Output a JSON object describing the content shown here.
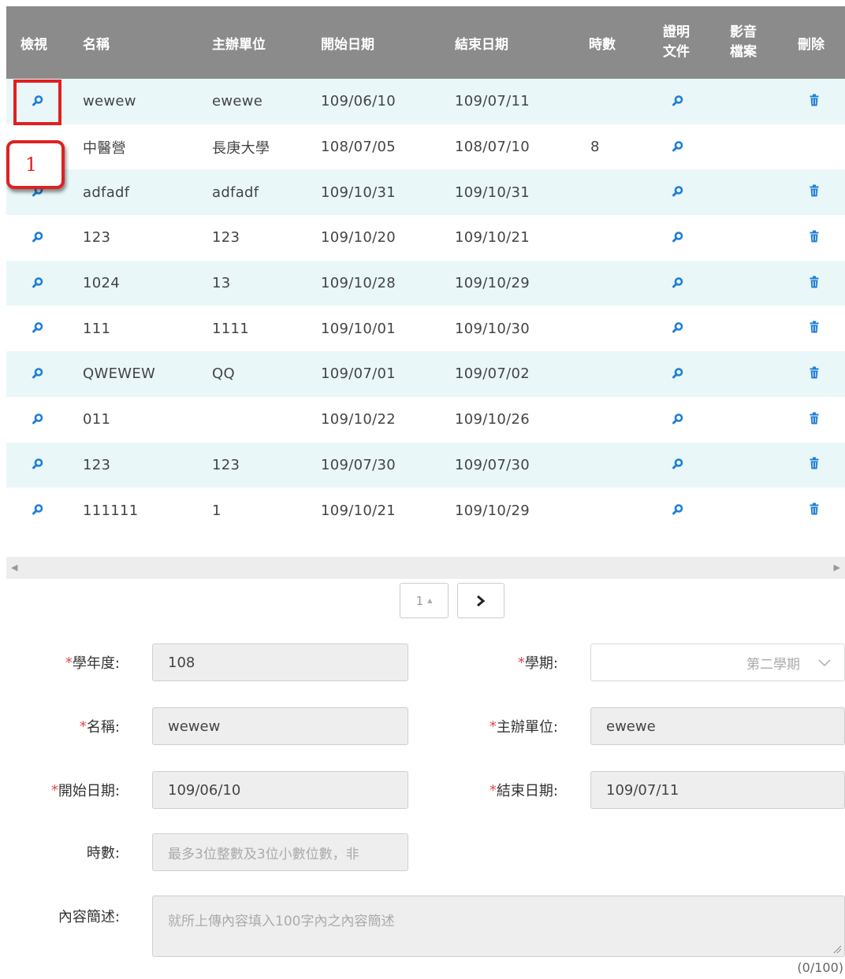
{
  "table": {
    "headers": {
      "view": "檢視",
      "name": "名稱",
      "organizer": "主辦單位",
      "start": "開始日期",
      "end": "結束日期",
      "hours": "時數",
      "proof_1": "證明",
      "proof_2": "文件",
      "media_1": "影音",
      "media_2": "檔案",
      "delete": "刪除"
    },
    "rows": [
      {
        "name": "wewew",
        "organizer": "ewewe",
        "start": "109/06/10",
        "end": "109/07/11",
        "hours": "",
        "deletable": true
      },
      {
        "name": "中醫營",
        "organizer": "長庚大學",
        "start": "108/07/05",
        "end": "108/07/10",
        "hours": "8",
        "deletable": false
      },
      {
        "name": "adfadf",
        "organizer": "adfadf",
        "start": "109/10/31",
        "end": "109/10/31",
        "hours": "",
        "deletable": true
      },
      {
        "name": "123",
        "organizer": "123",
        "start": "109/10/20",
        "end": "109/10/21",
        "hours": "",
        "deletable": true
      },
      {
        "name": "1024",
        "organizer": "13",
        "start": "109/10/28",
        "end": "109/10/29",
        "hours": "",
        "deletable": true
      },
      {
        "name": "111",
        "organizer": "1111",
        "start": "109/10/01",
        "end": "109/10/30",
        "hours": "",
        "deletable": true
      },
      {
        "name": "QWEWEW",
        "organizer": "QQ",
        "start": "109/07/01",
        "end": "109/07/02",
        "hours": "",
        "deletable": true
      },
      {
        "name": "011",
        "organizer": "",
        "start": "109/10/22",
        "end": "109/10/26",
        "hours": "",
        "deletable": true
      },
      {
        "name": "123",
        "organizer": "123",
        "start": "109/07/30",
        "end": "109/07/30",
        "hours": "",
        "deletable": true
      },
      {
        "name": "111111",
        "organizer": "1",
        "start": "109/10/21",
        "end": "109/10/29",
        "hours": "",
        "deletable": true
      }
    ]
  },
  "pager": {
    "page": "1",
    "sort_glyph": "▲"
  },
  "form": {
    "year_label": "學年度:",
    "year_value": "108",
    "semester_label": "學期:",
    "semester_value": "第二學期",
    "name_label": "名稱:",
    "name_value": "wewew",
    "organizer_label": "主辦單位:",
    "organizer_value": "ewewe",
    "start_label": "開始日期:",
    "start_value": "109/06/10",
    "end_label": "結束日期:",
    "end_value": "109/07/11",
    "hours_label": "時數:",
    "hours_placeholder": "最多3位整數及3位小數位數，非",
    "desc_label": "內容簡述:",
    "desc_placeholder": "就所上傳內容填入100字內之內容簡述",
    "counter": "(0/100)",
    "required_mark": "*"
  },
  "annotation": {
    "step": "1"
  },
  "colors": {
    "header_bg": "#8b8b8b",
    "row_alt_bg": "#e9f7f8",
    "icon_blue": "#1f7fd6",
    "required_red": "#e04848",
    "highlight_red": "#e02020"
  },
  "icons": {
    "view": "search-icon",
    "proof": "search-icon",
    "delete": "trash-icon",
    "semester_select": "chevron-down-icon",
    "next_page": "chevron-right-icon"
  }
}
